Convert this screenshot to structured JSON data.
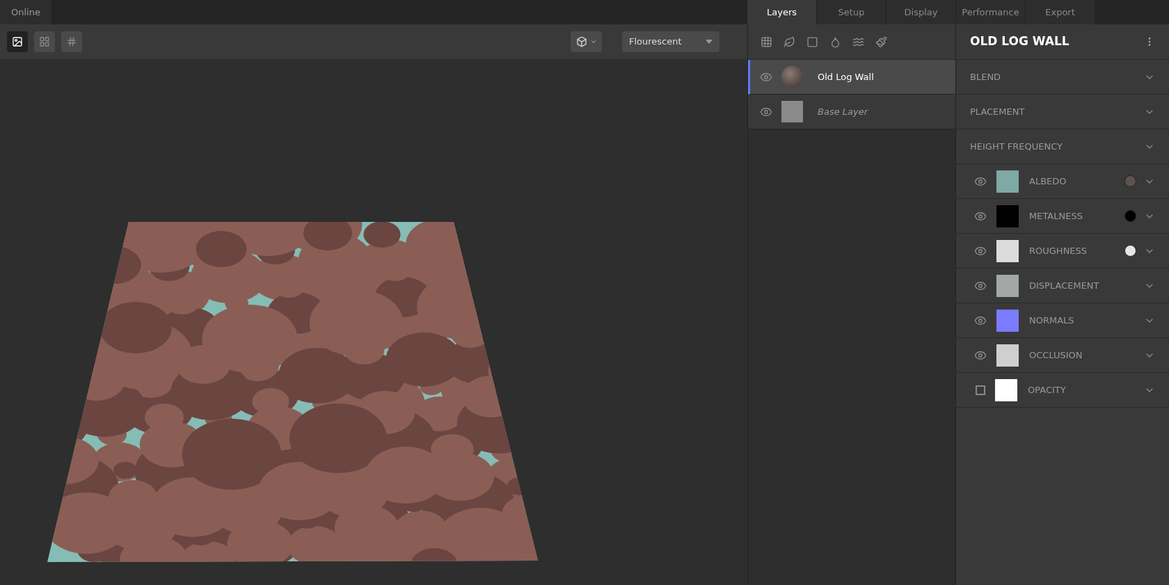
{
  "top_tabs": [
    {
      "label": "Online",
      "selected": true
    }
  ],
  "view_modes": [
    {
      "selected": true
    },
    {
      "selected": false
    },
    {
      "selected": false
    }
  ],
  "environment": {
    "value": "Flourescent"
  },
  "panel_tabs": [
    {
      "label": "Layers",
      "selected": true
    },
    {
      "label": "Setup",
      "selected": false
    },
    {
      "label": "Display",
      "selected": false
    },
    {
      "label": "Performance",
      "selected": false
    },
    {
      "label": "Export",
      "selected": false
    }
  ],
  "layers": [
    {
      "name": "Old Log Wall",
      "kind": "material",
      "selected": true
    },
    {
      "name": "Base Layer",
      "kind": "base",
      "selected": false
    }
  ],
  "properties": {
    "title": "OLD LOG WALL",
    "sections": [
      {
        "label": "BLEND",
        "expanded": false
      },
      {
        "label": "PLACEMENT",
        "expanded": false
      },
      {
        "label": "HEIGHT FREQUENCY",
        "expanded": false
      }
    ],
    "channels": [
      {
        "label": "ALBEDO",
        "enabled": true,
        "color": "#5e5250"
      },
      {
        "label": "METALNESS",
        "enabled": true,
        "color": "#000000"
      },
      {
        "label": "ROUGHNESS",
        "enabled": true,
        "color": "#e6e6e6"
      },
      {
        "label": "DISPLACEMENT",
        "enabled": true
      },
      {
        "label": "NORMALS",
        "enabled": true
      },
      {
        "label": "OCCLUSION",
        "enabled": true
      },
      {
        "label": "OPACITY",
        "enabled": false
      }
    ]
  }
}
